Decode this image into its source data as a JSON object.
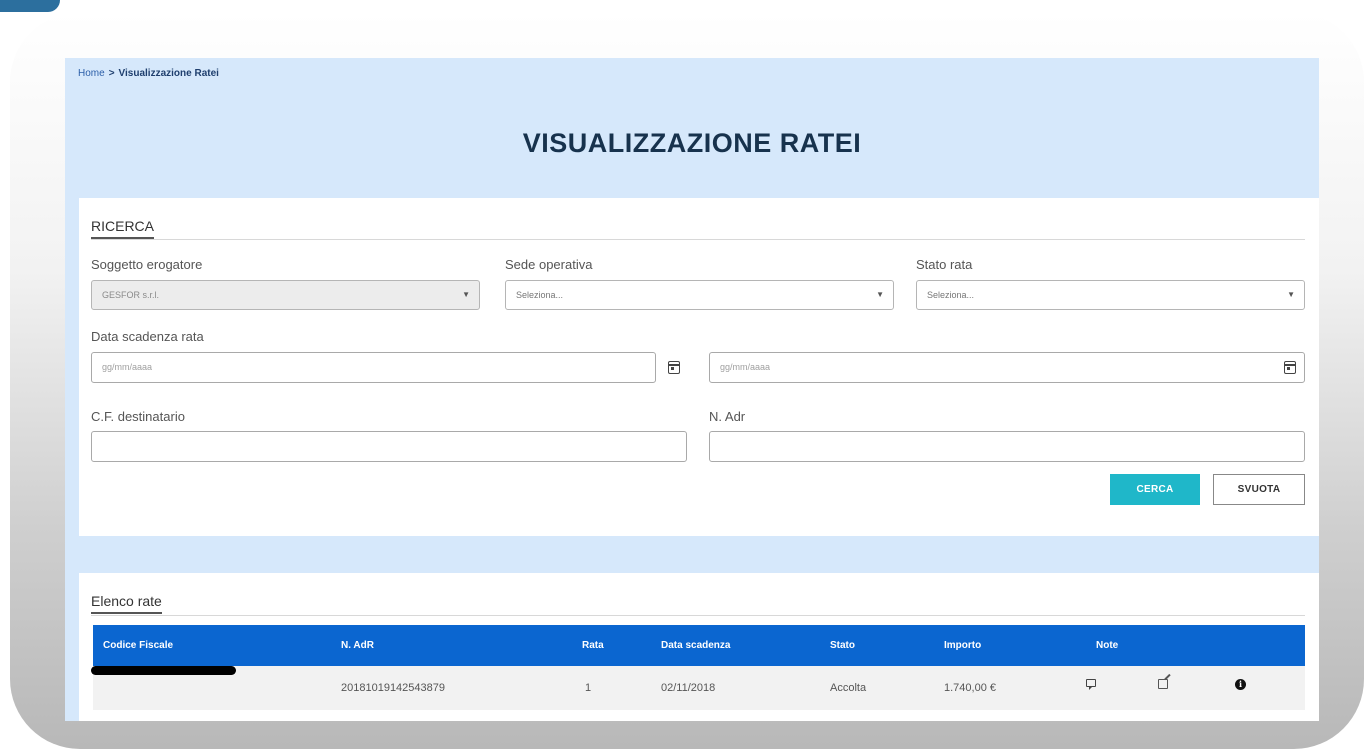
{
  "breadcrumb": {
    "home": "Home",
    "separator": ">",
    "current": "Visualizzazione Ratei"
  },
  "title": "VISUALIZZAZIONE RATEI",
  "search": {
    "section_title": "RICERCA",
    "soggetto_label": "Soggetto erogatore",
    "soggetto_value": "GESFOR s.r.l.",
    "sede_label": "Sede operativa",
    "sede_placeholder": "Seleziona...",
    "stato_label": "Stato rata",
    "stato_placeholder": "Seleziona...",
    "data_label": "Data scadenza rata",
    "data_from_placeholder": "gg/mm/aaaa",
    "data_to_placeholder": "gg/mm/aaaa",
    "cf_label": "C.F. destinatario",
    "cf_value": "",
    "nadr_label": "N. Adr",
    "nadr_value": "",
    "cerca_label": "CERCA",
    "svuota_label": "SVUOTA"
  },
  "list": {
    "section_title": "Elenco rate",
    "columns": {
      "codice_fiscale": "Codice Fiscale",
      "n_adr": "N. AdR",
      "rata": "Rata",
      "data_scadenza": "Data scadenza",
      "stato": "Stato",
      "importo": "Importo",
      "note": "Note"
    },
    "rows": [
      {
        "codice_fiscale": "",
        "n_adr": "20181019142543879",
        "rata": "1",
        "data_scadenza": "02/11/2018",
        "stato": "Accolta",
        "importo": "1.740,00 €"
      }
    ]
  },
  "colors": {
    "page_bg": "#d6e8fb",
    "table_header": "#0b66d0",
    "primary_button": "#1fb7c9",
    "title": "#17324d"
  },
  "icons": [
    "calendar-icon",
    "dropdown-arrow-icon",
    "comment-icon",
    "edit-icon",
    "info-icon"
  ]
}
